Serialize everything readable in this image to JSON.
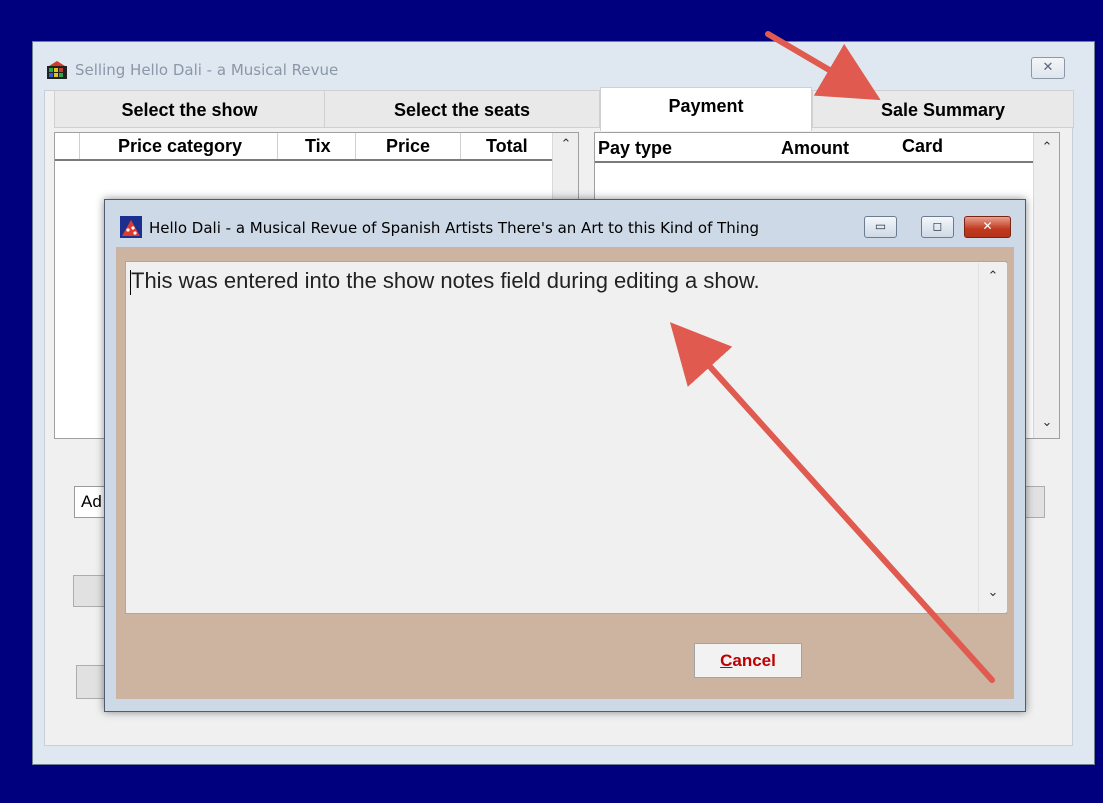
{
  "main_window": {
    "title": "Selling Hello Dali - a Musical Revue",
    "close_glyph": "✕",
    "tabs": [
      {
        "label": "Select the show",
        "active": false
      },
      {
        "label": "Select the seats",
        "active": false
      },
      {
        "label": "Payment",
        "active": true
      },
      {
        "label": "Sale Summary",
        "active": false
      }
    ],
    "price_grid": {
      "columns": [
        "Price category",
        "Tix",
        "Price",
        "Total"
      ]
    },
    "payment_grid": {
      "columns": [
        "Pay type",
        "Amount",
        "Card"
      ]
    },
    "partial_field_text": "Ad"
  },
  "dialog": {
    "title": "Hello Dali - a Musical Revue of Spanish Artists There's an Art to this Kind of Thing",
    "notes_text": "This was entered into the show notes field during editing a show.",
    "cancel_label_first": "C",
    "cancel_label_rest": "ancel",
    "minimize_glyph": "▭",
    "maximize_glyph": "◻",
    "close_glyph": "✕"
  },
  "colors": {
    "desktop": "#00007f",
    "annotation_arrow": "#e05a4f",
    "dialog_client": "#cdb4a0",
    "cancel_text": "#c00000"
  },
  "icons": {
    "scroll_up": "⌃",
    "scroll_down": "⌄"
  }
}
